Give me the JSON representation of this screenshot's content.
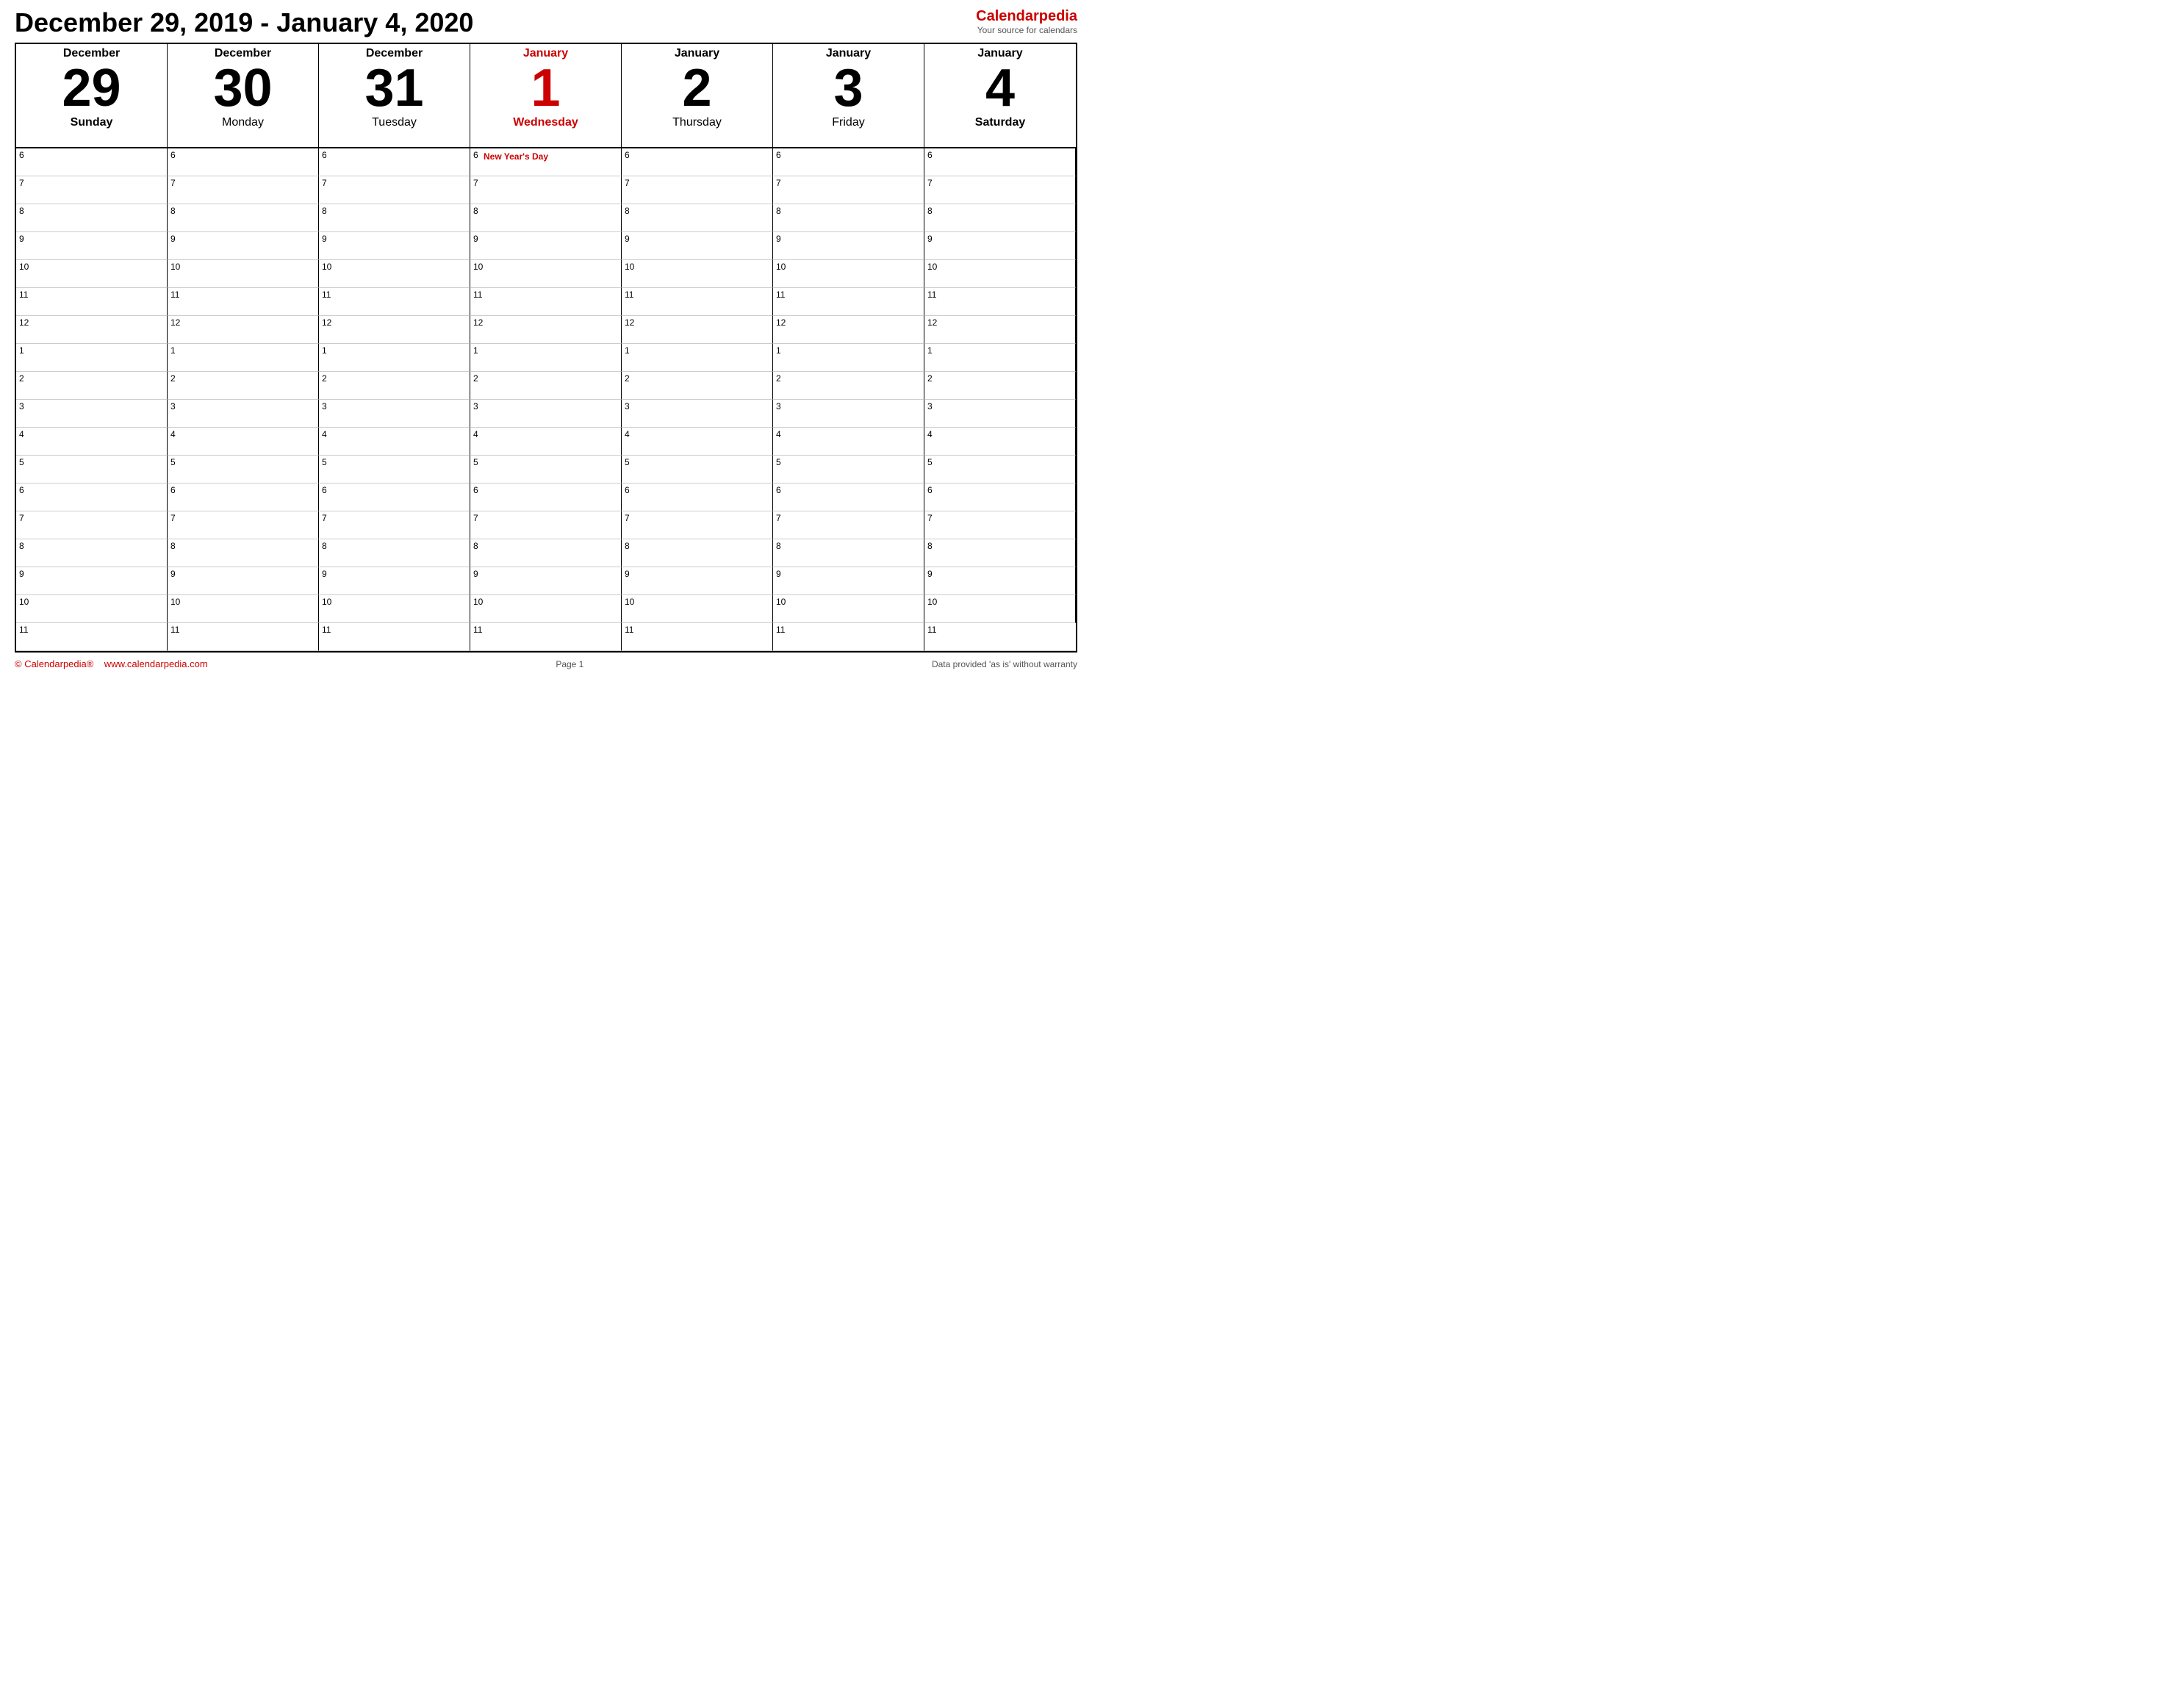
{
  "header": {
    "title": "December 29, 2019 - January 4, 2020",
    "brand_name": "Calendar",
    "brand_name_red": "pedia",
    "brand_tagline": "Your source for calendars"
  },
  "days": [
    {
      "month": "December",
      "month_red": false,
      "number": "29",
      "number_red": false,
      "day_name": "Sunday",
      "day_name_style": "bold-black"
    },
    {
      "month": "December",
      "month_red": false,
      "number": "30",
      "number_red": false,
      "day_name": "Monday",
      "day_name_style": "normal"
    },
    {
      "month": "December",
      "month_red": false,
      "number": "31",
      "number_red": false,
      "day_name": "Tuesday",
      "day_name_style": "normal"
    },
    {
      "month": "January",
      "month_red": true,
      "number": "1",
      "number_red": true,
      "day_name": "Wednesday",
      "day_name_style": "bold-red"
    },
    {
      "month": "January",
      "month_red": false,
      "number": "2",
      "number_red": false,
      "day_name": "Thursday",
      "day_name_style": "normal"
    },
    {
      "month": "January",
      "month_red": false,
      "number": "3",
      "number_red": false,
      "day_name": "Friday",
      "day_name_style": "normal"
    },
    {
      "month": "January",
      "month_red": false,
      "number": "4",
      "number_red": false,
      "day_name": "Saturday",
      "day_name_style": "bold-black"
    }
  ],
  "time_slots": [
    "6",
    "7",
    "8",
    "9",
    "10",
    "11",
    "12",
    "1",
    "2",
    "3",
    "4",
    "5",
    "6",
    "7",
    "8",
    "9",
    "10",
    "11"
  ],
  "new_years_day": "New Year's Day",
  "footer": {
    "copyright": "© Calendarpedia®",
    "website": "www.calendarpedia.com",
    "page": "Page 1",
    "disclaimer": "Data provided 'as is' without warranty"
  }
}
